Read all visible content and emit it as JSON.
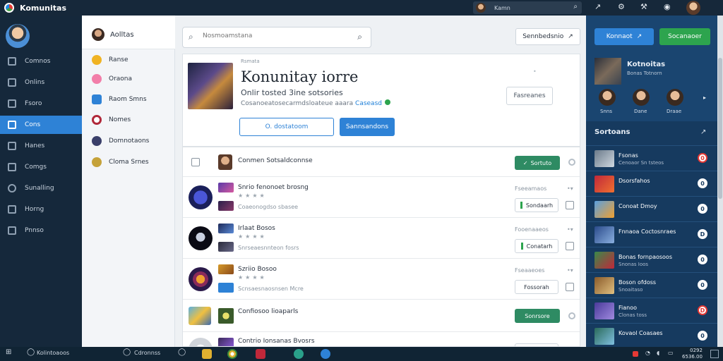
{
  "app": {
    "title": "Komunitas"
  },
  "titlebar": {
    "search_text": "Kamn"
  },
  "leftnav": {
    "items": [
      {
        "label": "Comnos"
      },
      {
        "label": "Onlins"
      },
      {
        "label": "Fsoro"
      },
      {
        "label": "Cons"
      },
      {
        "label": "Hanes"
      },
      {
        "label": "Comgs"
      },
      {
        "label": "Sunalling"
      },
      {
        "label": "Horng"
      },
      {
        "label": "Pnnso"
      }
    ]
  },
  "channels": {
    "header": "Aolltas",
    "items": [
      {
        "label": "Ranse",
        "color": "#f0b323"
      },
      {
        "label": "Oraona",
        "color": "#f27ea9"
      },
      {
        "label": "Raom Smns",
        "color": "#2e82d6"
      },
      {
        "label": "Nomes",
        "color": "#b0283a"
      },
      {
        "label": "Domnotaons",
        "color": "#3a3f6a"
      },
      {
        "label": "Cloma Srnes",
        "color": "#c5a23a"
      }
    ]
  },
  "main": {
    "search_placeholder": "Nosmoamstana",
    "sort_label": "Sennbedsnio",
    "hero": {
      "small_label": "Rsmata",
      "title": "Konunitay iorre",
      "subtitle": "Onlir tosted 3ine sotsories",
      "desc_text": "Cosanoeatosecarmdsloateue aaara",
      "desc_link": "Caseasd",
      "btn_outline": "O. dostatoom",
      "btn_fill": "Sannsandons",
      "right_button": "Fasreanes"
    },
    "list_header": {
      "label": "Conmen Sotsaldconnse",
      "button": "Sortuto"
    },
    "rows": [
      {
        "name": "Snrio fenonoet brosng",
        "meta": "Coaeonogdso sbasee",
        "right_meta": "Fseeamaos",
        "button": "Sondaarh"
      },
      {
        "name": "Irlaat Bosos",
        "meta": "Snrseaesnnteon fosrs",
        "right_meta": "Fooenaaeos",
        "button": "Conatarh"
      },
      {
        "name": "Szriio Bosoo",
        "meta": "Scnsaesnaosnsen Mcre",
        "right_meta": "Fseaaeoes",
        "button": "Fossorah"
      },
      {
        "name": "Confiosoo lioaparls",
        "meta": "",
        "right_meta": "",
        "button": "Sonrsore"
      },
      {
        "name": "Contrio Ionsanas Bvosrs",
        "meta": "",
        "right_meta": "",
        "button": ""
      }
    ]
  },
  "rpanel": {
    "btn_blue": "Konnaot",
    "btn_green": "Socanaoer",
    "card_title": "Kotnoitas",
    "card_sub": "Bonas Totnorn",
    "avatars": [
      {
        "label": "Snns"
      },
      {
        "label": "Dane"
      },
      {
        "label": "Draae"
      }
    ],
    "section": "Sortoans",
    "items": [
      {
        "t1": "Fsonas",
        "t2": "Cenoaor Sn tsteos",
        "badge": "0"
      },
      {
        "t1": "Dsorsfahos",
        "t2": "",
        "badge": "0"
      },
      {
        "t1": "Conoat Dmoy",
        "t2": "",
        "badge": "0"
      },
      {
        "t1": "Fnnaoa Coctosnraes",
        "t2": "",
        "badge": "D"
      },
      {
        "t1": "Bonas fornpaosoos",
        "t2": "Snonas Ioos",
        "badge": "0"
      },
      {
        "t1": "Boson ofdoss",
        "t2": "Snoaitaso",
        "badge": "0"
      },
      {
        "t1": "Fianoo",
        "t2": "Clonas toss",
        "badge": "D"
      },
      {
        "t1": "Kovaol Coasaes",
        "t2": "",
        "badge": "0"
      }
    ]
  },
  "taskbar": {
    "search_label": "Kolintoaoos",
    "app_label": "Cdronnss",
    "clock_time": "0292",
    "clock_date": "6536.00"
  }
}
